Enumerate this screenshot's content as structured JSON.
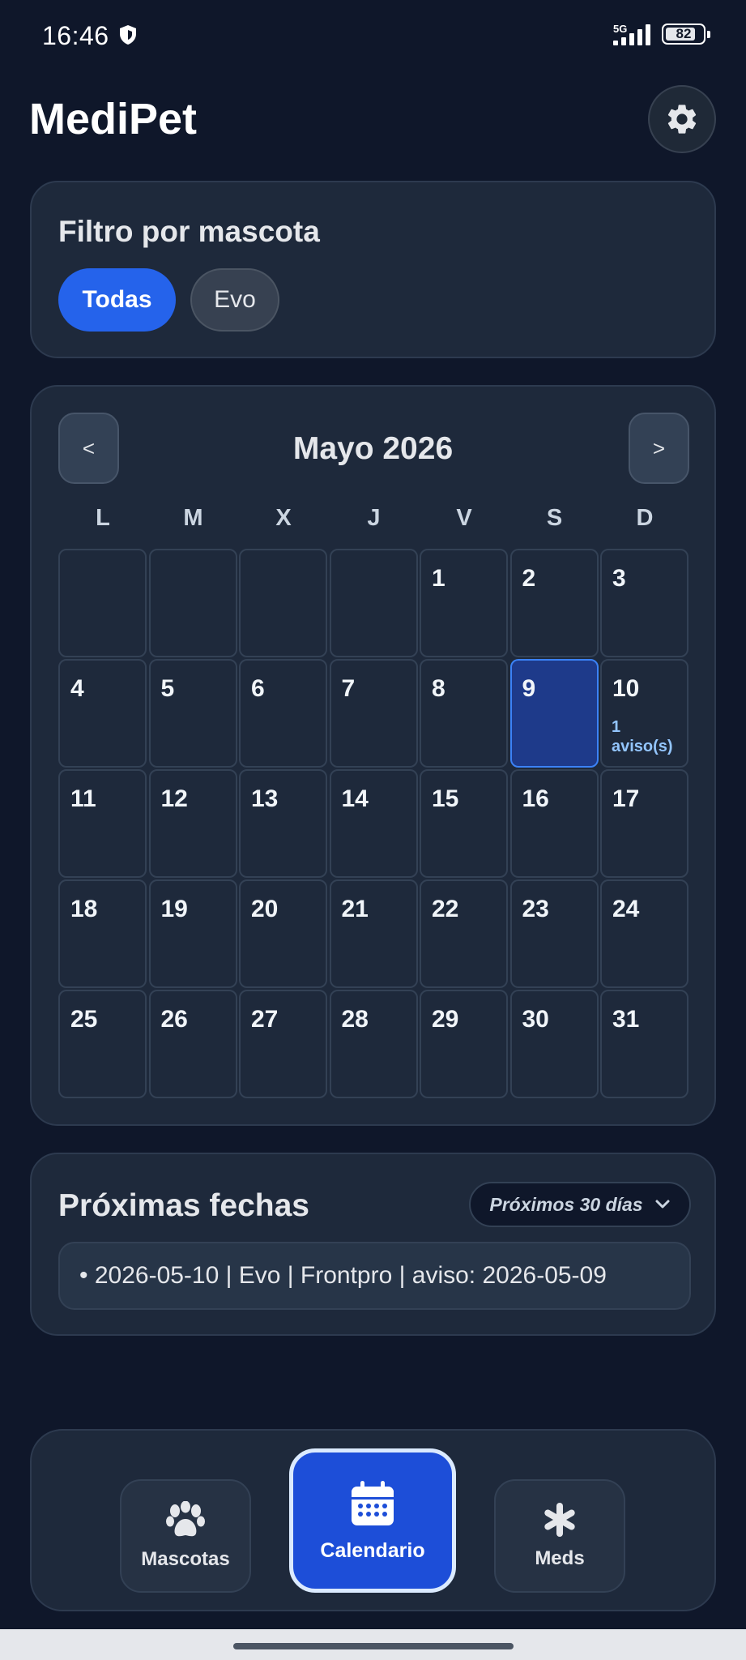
{
  "status_bar": {
    "time": "16:46",
    "network": "5G",
    "battery": "82",
    "battery_level_percent": 82
  },
  "header": {
    "title": "MediPet"
  },
  "filter": {
    "title": "Filtro por mascota",
    "chips": [
      "Todas",
      "Evo"
    ],
    "selected": "Todas"
  },
  "calendar": {
    "month_label": "Mayo 2026",
    "prev_label": "<",
    "next_label": ">",
    "weekdays": [
      "L",
      "M",
      "X",
      "J",
      "V",
      "S",
      "D"
    ],
    "selected_day": "9",
    "days": [
      "",
      "",
      "",
      "",
      "1",
      "2",
      "3",
      "4",
      "5",
      "6",
      "7",
      "8",
      "9",
      "10",
      "11",
      "12",
      "13",
      "14",
      "15",
      "16",
      "17",
      "18",
      "19",
      "20",
      "21",
      "22",
      "23",
      "24",
      "25",
      "26",
      "27",
      "28",
      "29",
      "30",
      "31"
    ],
    "notes": {
      "10": "1 aviso(s)"
    }
  },
  "upcoming": {
    "title": "Próximas fechas",
    "range_label": "Próximos 30 días",
    "items": [
      "• 2026-05-10 | Evo | Frontpro | aviso: 2026-05-09"
    ]
  },
  "bottom_nav": {
    "pets_label": "Mascotas",
    "calendar_label": "Calendario",
    "meds_label": "Meds",
    "active": "Calendario"
  },
  "colors": {
    "background": "#0f172a",
    "card": "#1e293b",
    "accent": "#2563eb",
    "selected_day": "#1e3a8a",
    "note_text": "#93c5fd"
  }
}
